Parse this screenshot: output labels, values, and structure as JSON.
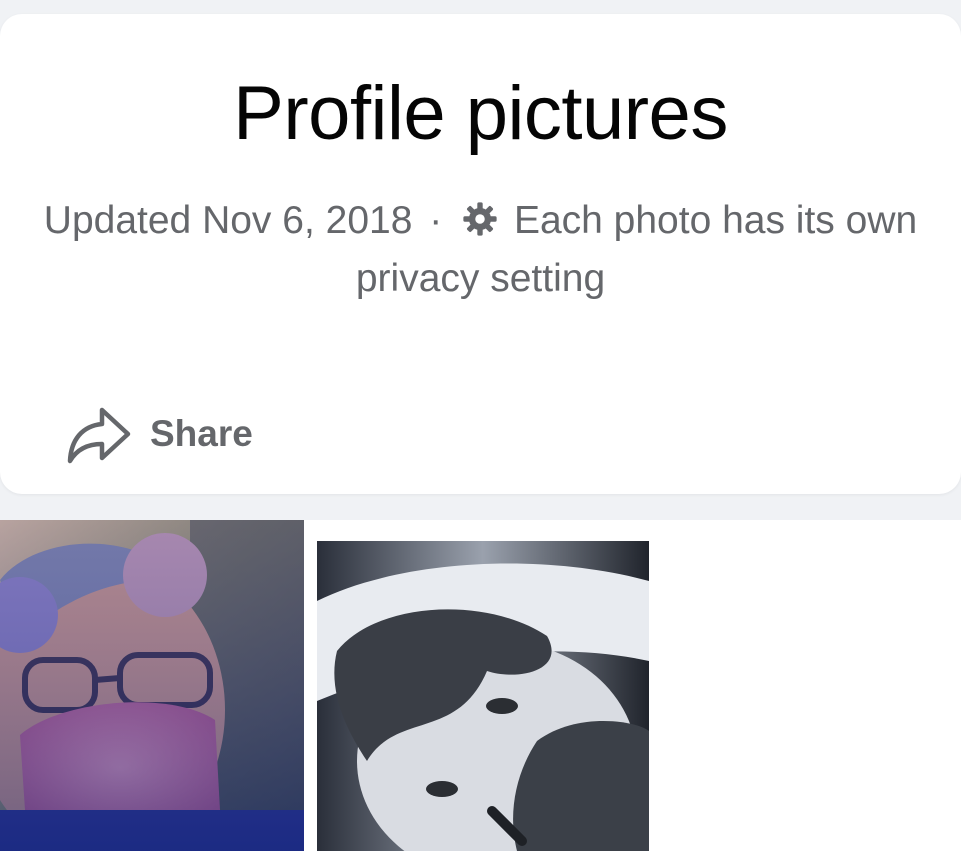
{
  "album": {
    "title": "Profile pictures",
    "updated": "Updated Nov 6, 2018",
    "separator": "·",
    "privacy_icon": "gear-icon",
    "privacy_text": "Each photo has its own privacy setting",
    "share_icon": "share-arrow-icon",
    "share_label": "Share"
  },
  "photos": [
    {
      "index": 1,
      "kind": "profile-photo-thumbnail"
    },
    {
      "index": 2,
      "kind": "profile-photo-thumbnail"
    }
  ],
  "colors": {
    "title_text": "#050505",
    "secondary_text": "#65676b",
    "card_background": "#ffffff",
    "page_background": "#f0f2f5"
  }
}
